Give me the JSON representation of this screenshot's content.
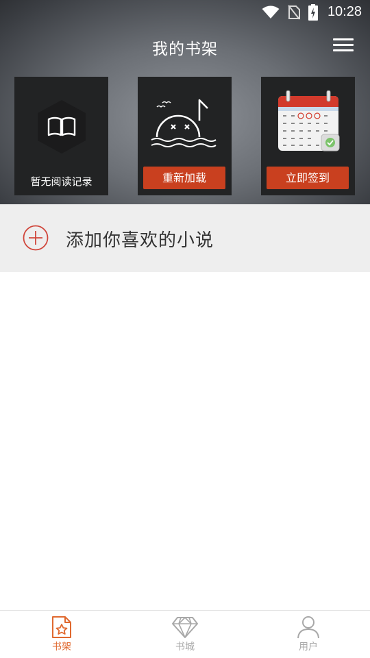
{
  "status_bar": {
    "time": "10:28",
    "icons": [
      "wifi-icon",
      "no-sim-icon",
      "battery-charging-icon"
    ]
  },
  "header": {
    "title": "我的书架",
    "menu_icon": "menu-icon"
  },
  "cards": [
    {
      "icon": "book-icon",
      "label": "暂无阅读记录"
    },
    {
      "icon": "sinking-face-icon",
      "button_label": "重新加载"
    },
    {
      "icon": "calendar-icon",
      "button_label": "立即签到"
    }
  ],
  "add_row": {
    "icon": "plus-circle-icon",
    "label": "添加你喜欢的小说"
  },
  "bottom_nav": [
    {
      "label": "书架",
      "icon": "bookshelf-icon",
      "active": true
    },
    {
      "label": "书城",
      "icon": "diamond-icon",
      "active": false
    },
    {
      "label": "用户",
      "icon": "user-icon",
      "active": false
    }
  ],
  "colors": {
    "accent": "#c9401f",
    "nav_active": "#e0692f",
    "nav_inactive": "#a8a8a8",
    "add_icon": "#d0453a"
  }
}
